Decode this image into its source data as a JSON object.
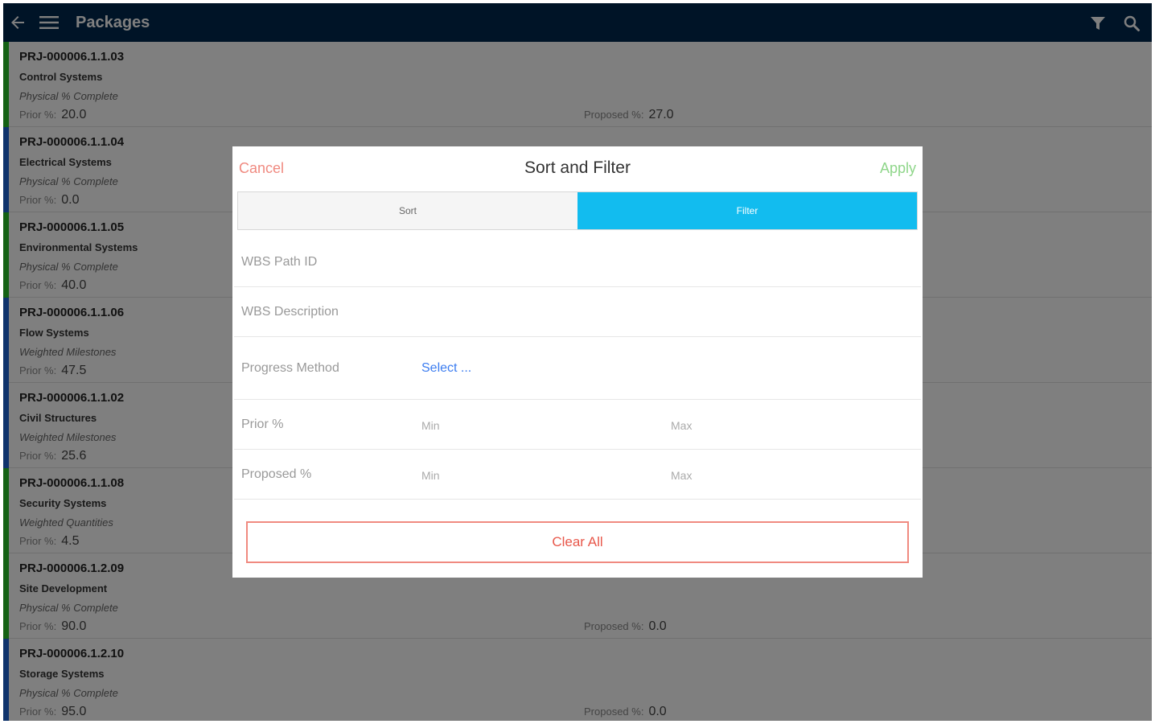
{
  "header": {
    "title": "Packages",
    "colors": {
      "background": "#00294f",
      "text": "#ffffff"
    }
  },
  "list": [
    {
      "id": "PRJ-000006.1.1.03",
      "desc": "Control Systems",
      "method": "Physical % Complete",
      "prior_label": "Prior %:",
      "prior": "20.0",
      "proposed_label": "Proposed %:",
      "proposed": "27.0",
      "status_color": "#29c229"
    },
    {
      "id": "PRJ-000006.1.1.04",
      "desc": "Electrical Systems",
      "method": "Physical % Complete",
      "prior_label": "Prior %:",
      "prior": "0.0",
      "proposed_label": "",
      "proposed": "",
      "status_color": "#1e66d8"
    },
    {
      "id": "PRJ-000006.1.1.05",
      "desc": "Environmental Systems",
      "method": "Physical % Complete",
      "prior_label": "Prior %:",
      "prior": "40.0",
      "proposed_label": "",
      "proposed": "",
      "status_color": "#29c229"
    },
    {
      "id": "PRJ-000006.1.1.06",
      "desc": "Flow Systems",
      "method": "Weighted Milestones",
      "prior_label": "Prior %:",
      "prior": "47.5",
      "proposed_label": "",
      "proposed": "",
      "status_color": "#1e66d8"
    },
    {
      "id": "PRJ-000006.1.1.02",
      "desc": "Civil Structures",
      "method": "Weighted Milestones",
      "prior_label": "Prior %:",
      "prior": "25.6",
      "proposed_label": "",
      "proposed": "",
      "status_color": "#1e66d8"
    },
    {
      "id": "PRJ-000006.1.1.08",
      "desc": "Security Systems",
      "method": "Weighted Quantities",
      "prior_label": "Prior %:",
      "prior": "4.5",
      "proposed_label": "",
      "proposed": "",
      "status_color": "#29c229"
    },
    {
      "id": "PRJ-000006.1.2.09",
      "desc": "Site Development",
      "method": "Physical % Complete",
      "prior_label": "Prior %:",
      "prior": "90.0",
      "proposed_label": "Proposed %:",
      "proposed": "0.0",
      "status_color": "#29c229"
    },
    {
      "id": "PRJ-000006.1.2.10",
      "desc": "Storage Systems",
      "method": "Physical % Complete",
      "prior_label": "Prior %:",
      "prior": "95.0",
      "proposed_label": "Proposed %:",
      "proposed": "0.0",
      "status_color": "#1e66d8"
    }
  ],
  "dialog": {
    "cancel": "Cancel",
    "title": "Sort and Filter",
    "apply": "Apply",
    "tabs": {
      "sort": "Sort",
      "filter": "Filter",
      "active": "filter"
    },
    "fields": {
      "wbs_path_id": "WBS Path ID",
      "wbs_description": "WBS Description",
      "progress_method": {
        "label": "Progress Method",
        "value": "Select ..."
      },
      "prior": {
        "label": "Prior %",
        "min": "Min",
        "max": "Max"
      },
      "proposed": {
        "label": "Proposed %",
        "min": "Min",
        "max": "Max"
      }
    },
    "clear_all": "Clear All",
    "colors": {
      "cancel": "#f08a80",
      "apply": "#8fd68a",
      "active_tab": "#12bcef",
      "link": "#3b7cf0",
      "clear": "#e8574a"
    }
  }
}
